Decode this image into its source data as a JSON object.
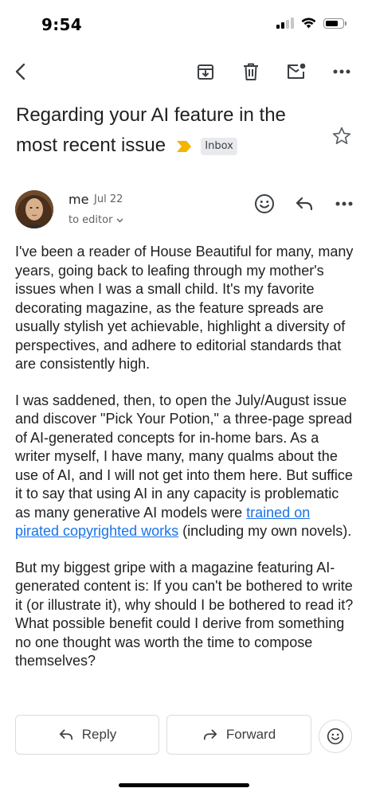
{
  "status_bar": {
    "time": "9:54",
    "signal_bars_filled": 2,
    "signal_bars_total": 4,
    "battery_level": 0.8
  },
  "toolbar": {
    "icons": [
      "back-arrow-icon",
      "archive-icon",
      "delete-icon",
      "mark-unread-icon",
      "more-options-icon"
    ]
  },
  "email": {
    "subject": "Regarding your AI feature in the most recent issue",
    "label": "Inbox",
    "important_marker_color": "#f4b400",
    "sender_name": "me",
    "date": "Jul 22",
    "recipient": "to editor",
    "body": {
      "p1": "I've been a reader of House Beautiful for many, many years, going back to leafing through my mother's issues when I was a small child. It's my favorite decorating magazine, as the feature spreads are usually stylish yet achievable, highlight a diversity of perspectives, and adhere to editorial standards that are consistently high.",
      "p2_before_link": "I was saddened, then, to open the July/August issue and discover \"Pick Your Potion,\" a three-page spread of AI-generated concepts for in-home bars. As a writer myself, I have many, many qualms about the use of AI, and I will not get into them here. But suffice it to say that using AI in any capacity is problematic as many generative AI models were ",
      "p2_link": "trained on pirated copyrighted works",
      "p2_after_link": " (including my own novels).",
      "p3": "But my biggest gripe with a magazine featuring AI-generated content is: If you can't be bothered to write it (or illustrate it), why should I be bothered to read it? What possible benefit could I derive from something no one thought was worth the time to compose themselves?"
    }
  },
  "actions": {
    "reply_label": "Reply",
    "forward_label": "Forward"
  },
  "colors": {
    "link": "#1a73e8",
    "text": "#202124",
    "secondary": "#5f6368",
    "border": "#dadce0"
  }
}
